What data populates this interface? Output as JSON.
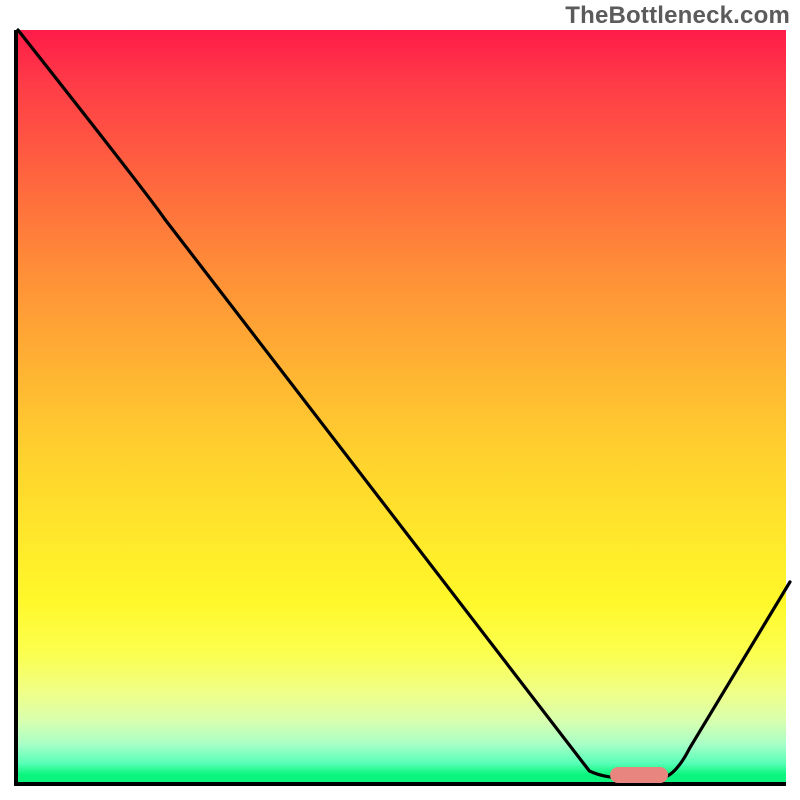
{
  "watermark": "TheBottleneck.com",
  "chart_data": {
    "type": "line",
    "title": "",
    "xlabel": "",
    "ylabel": "",
    "xlim": [
      0,
      100
    ],
    "ylim": [
      0,
      100
    ],
    "categories_note": "no axis labels visible",
    "series": [
      {
        "name": "curve",
        "points": [
          {
            "x": 0,
            "y": 100
          },
          {
            "x": 17,
            "y": 78
          },
          {
            "x": 74,
            "y": 2
          },
          {
            "x": 76,
            "y": 1
          },
          {
            "x": 83,
            "y": 1
          },
          {
            "x": 100,
            "y": 27
          }
        ]
      }
    ],
    "marker": {
      "x_center": 80.5,
      "y_center": 1.5,
      "width_pct": 7.5,
      "color": "#e8857f"
    },
    "background_gradient": {
      "top": "#ff1b49",
      "bottom": "#0bf57e",
      "description": "vertical red-to-yellow-to-green"
    }
  }
}
